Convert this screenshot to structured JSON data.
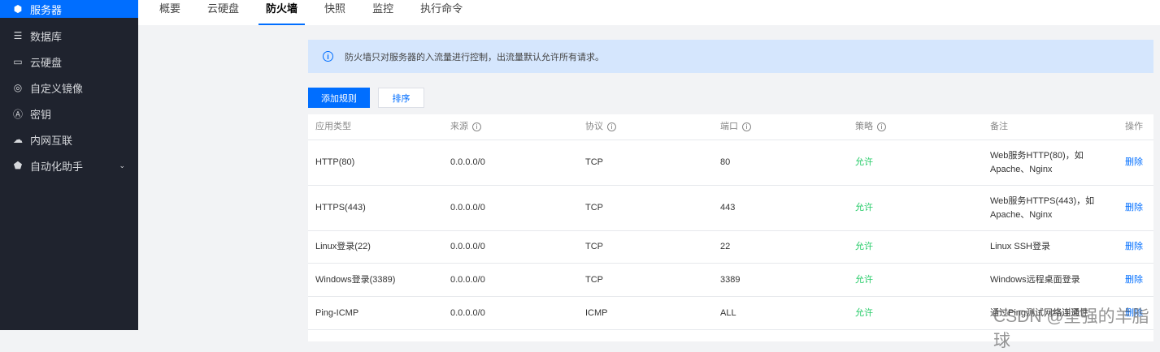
{
  "sidebar": {
    "items": [
      {
        "label": "服务器",
        "icon": "server-icon"
      },
      {
        "label": "数据库",
        "icon": "database-icon"
      },
      {
        "label": "云硬盘",
        "icon": "disk-icon"
      },
      {
        "label": "自定义镜像",
        "icon": "image-icon"
      },
      {
        "label": "密钥",
        "icon": "key-icon"
      },
      {
        "label": "内网互联",
        "icon": "network-icon"
      },
      {
        "label": "自动化助手",
        "icon": "automation-icon"
      }
    ]
  },
  "tabs": [
    "概要",
    "云硬盘",
    "防火墙",
    "快照",
    "监控",
    "执行命令"
  ],
  "alert": "防火墙只对服务器的入流量进行控制，出流量默认允许所有请求。",
  "buttons": {
    "add": "添加规则",
    "sort": "排序"
  },
  "table": {
    "headers": [
      "应用类型",
      "来源",
      "协议",
      "端口",
      "策略",
      "备注",
      "操作"
    ],
    "rows": [
      [
        "HTTP(80)",
        "0.0.0.0/0",
        "TCP",
        "80",
        "允许",
        "Web服务HTTP(80)，如 Apache、Nginx",
        "删除"
      ],
      [
        "HTTPS(443)",
        "0.0.0.0/0",
        "TCP",
        "443",
        "允许",
        "Web服务HTTPS(443)，如 Apache、Nginx",
        "删除"
      ],
      [
        "Linux登录(22)",
        "0.0.0.0/0",
        "TCP",
        "22",
        "允许",
        "Linux SSH登录",
        "删除"
      ],
      [
        "Windows登录(3389)",
        "0.0.0.0/0",
        "TCP",
        "3389",
        "允许",
        "Windows远程桌面登录",
        "删除"
      ],
      [
        "Ping-ICMP",
        "0.0.0.0/0",
        "ICMP",
        "ALL",
        "允许",
        "通过Ping测试网络连通性",
        "删除"
      ]
    ]
  },
  "watermark": "CSDN @坚强的羊脂球"
}
